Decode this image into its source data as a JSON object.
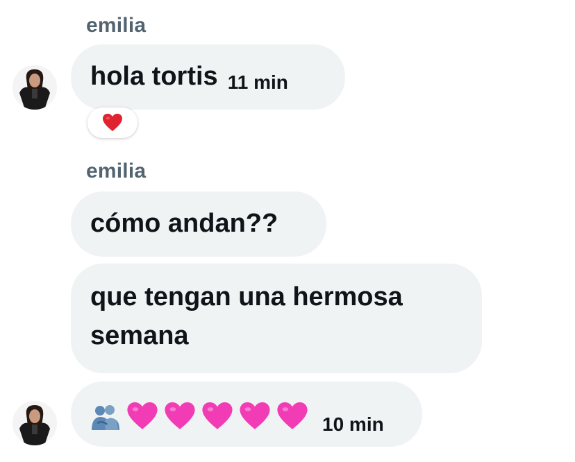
{
  "messages": [
    {
      "sender": "emilia",
      "text": "hola tortis",
      "time": "11 min",
      "reaction": "red-heart"
    },
    {
      "sender": "emilia",
      "text": "cómo andan??"
    },
    {
      "text_line1": "que tengan una hermosa",
      "text_line2": "semana"
    },
    {
      "emojis": [
        "people-hugging",
        "pink-heart",
        "pink-heart",
        "pink-heart",
        "pink-heart",
        "pink-heart"
      ],
      "time": "10 min"
    }
  ],
  "colors": {
    "bubble": "#eff3f4",
    "name": "#536471",
    "text": "#0f1419",
    "pink_heart": "#f23cb5",
    "red_heart": "#e0242f"
  }
}
